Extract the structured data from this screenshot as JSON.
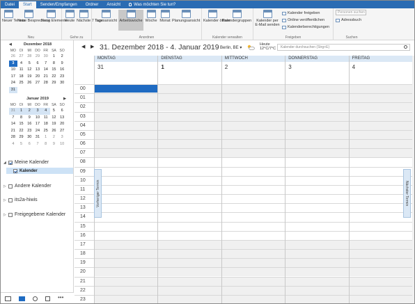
{
  "tabs": [
    "Datei",
    "Start",
    "Senden/Empfangen",
    "Ordner",
    "Ansicht"
  ],
  "tell_me": "Was möchten Sie tun?",
  "ribbon": {
    "neu": {
      "label": "Neu",
      "buttons": [
        "Neuer Termin",
        "Neue Besprechung",
        "Neue Elemente"
      ]
    },
    "gehezu": {
      "label": "Gehe zu",
      "buttons": [
        "Heute",
        "Nächste 7 Tage"
      ]
    },
    "anordnen": {
      "label": "Anordnen",
      "buttons": [
        "Tagesansicht",
        "Arbeitswoche",
        "Woche",
        "Monat",
        "Planungsansicht"
      ]
    },
    "kalverw": {
      "label": "Kalender verwalten",
      "buttons": [
        "Kalender öffnen",
        "Kalendergruppen"
      ]
    },
    "freigeben": {
      "label": "Freigeben",
      "big": "Kalender per E-Mail senden",
      "small": [
        "Kalender freigeben",
        "Online veröffentlichen",
        "Kalenderberechtigungen"
      ]
    },
    "suchen": {
      "label": "Suchen",
      "placeholder": "Personen suchen",
      "adressbuch": "Adressbuch"
    }
  },
  "minical1": {
    "title": "Dezember 2018",
    "dows": [
      "MO",
      "DI",
      "MI",
      "DO",
      "FR",
      "SA",
      "SO"
    ],
    "days": [
      "26",
      "27",
      "28",
      "29",
      "30",
      "1",
      "2",
      "3",
      "4",
      "5",
      "6",
      "7",
      "8",
      "9",
      "10",
      "11",
      "12",
      "13",
      "14",
      "15",
      "16",
      "17",
      "18",
      "19",
      "20",
      "21",
      "22",
      "23",
      "24",
      "25",
      "26",
      "27",
      "28",
      "29",
      "30",
      "31"
    ]
  },
  "minical2": {
    "title": "Januar 2019",
    "dows": [
      "MO",
      "DI",
      "MI",
      "DO",
      "FR",
      "SA",
      "SO"
    ],
    "days": [
      "31",
      "1",
      "2",
      "3",
      "4",
      "5",
      "6",
      "7",
      "8",
      "9",
      "10",
      "11",
      "12",
      "13",
      "14",
      "15",
      "16",
      "17",
      "18",
      "19",
      "20",
      "21",
      "22",
      "23",
      "24",
      "25",
      "26",
      "27",
      "28",
      "29",
      "30",
      "31",
      "1",
      "2",
      "3",
      "4",
      "5",
      "6",
      "7",
      "8",
      "9",
      "10"
    ]
  },
  "folders": {
    "meine": "Meine Kalender",
    "kalender": "Kalender",
    "andere": "Andere Kalender",
    "its": "its2a-hiwis",
    "freigegeben": "Freigegebene Kalender"
  },
  "calendar": {
    "range": "31. Dezember 2018 - 4. Januar 2019",
    "city": "Berlin, BE",
    "weather_label": "Heute",
    "weather_temp": "12°C/7°C",
    "search_placeholder": "Kalender durchsuchen (Strg+E)",
    "days": [
      {
        "name": "MONTAG",
        "num": "31"
      },
      {
        "name": "DIENSTAG",
        "num": "1"
      },
      {
        "name": "MITTWOCH",
        "num": "2"
      },
      {
        "name": "DONNERSTAG",
        "num": "3"
      },
      {
        "name": "FREITAG",
        "num": "4"
      }
    ],
    "hours": [
      "00",
      "01",
      "02",
      "03",
      "04",
      "05",
      "06",
      "07",
      "08",
      "09",
      "10",
      "11",
      "12",
      "13",
      "14",
      "15",
      "16",
      "17",
      "18",
      "19",
      "20",
      "21",
      "22",
      "23"
    ],
    "prev_label": "Vorheriger Termin",
    "next_label": "Nächster Termin"
  }
}
